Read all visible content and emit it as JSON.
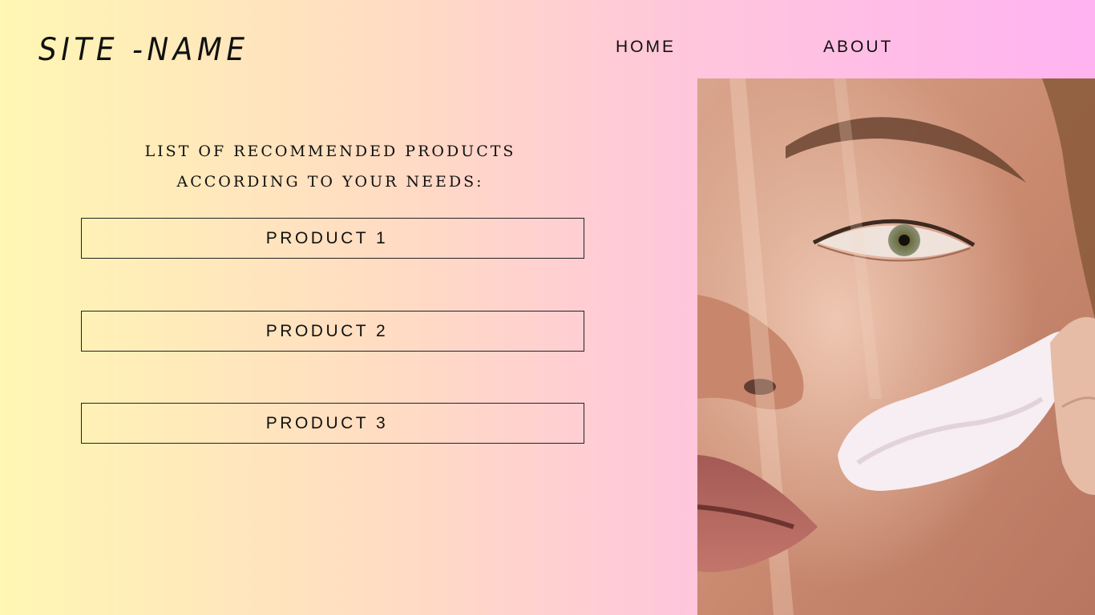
{
  "header": {
    "site_name": "SITE -NAME",
    "nav": [
      {
        "label": "HOME"
      },
      {
        "label": "ABOUT"
      }
    ]
  },
  "main": {
    "heading_line1": "LIST OF RECOMMENDED PRODUCTS",
    "heading_line2": "ACCORDING TO YOUR NEEDS:",
    "products": [
      {
        "label": "PRODUCT 1"
      },
      {
        "label": "PRODUCT 2"
      },
      {
        "label": "PRODUCT 3"
      }
    ]
  },
  "colors": {
    "gradient_start": "#fff7b3",
    "gradient_mid": "#ffc6dc",
    "gradient_end": "#ffb3f1",
    "text": "#111111"
  }
}
